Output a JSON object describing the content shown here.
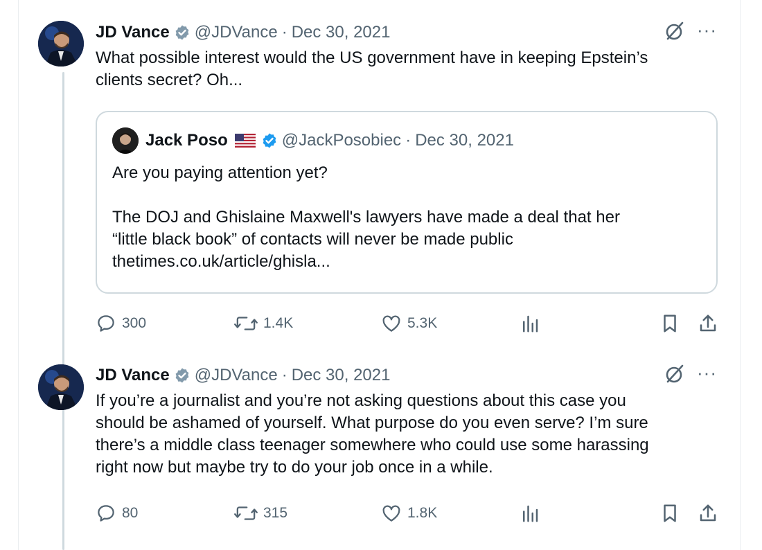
{
  "tweets": [
    {
      "author": {
        "name": "JD Vance",
        "handle": "@JDVance",
        "date": "Dec 30, 2021"
      },
      "text": "What possible interest would the US government have in keeping Epstein’s\nclients secret? Oh...",
      "quote": {
        "author": {
          "name": "Jack Poso",
          "handle": "@JackPosobiec",
          "date": "Dec 30, 2021"
        },
        "text": "Are you paying attention yet?\n\nThe DOJ and Ghislaine Maxwell's lawyers have made a deal that her\n“little black book” of contacts will never be made public\nthetimes.co.uk/article/ghisla..."
      },
      "stats": {
        "replies": "300",
        "reposts": "1.4K",
        "likes": "5.3K"
      }
    },
    {
      "author": {
        "name": "JD Vance",
        "handle": "@JDVance",
        "date": "Dec 30, 2021"
      },
      "text": "If you’re a journalist and you’re not asking questions about this case you\nshould be ashamed of yourself. What purpose do you even serve? I’m sure\nthere’s a middle class teenager somewhere who could use some harassing\nright now but maybe try to do your job once in a while.",
      "stats": {
        "replies": "80",
        "reposts": "315",
        "likes": "1.8K"
      }
    }
  ],
  "ui": {
    "separator": "·",
    "more": "···"
  },
  "colors": {
    "verified": "#829aab",
    "muted": "#536471",
    "text": "#0f1419",
    "border": "#cfd9de"
  },
  "icons": [
    "verified-badge-icon",
    "grok-icon",
    "more-icon",
    "reply-icon",
    "repost-icon",
    "like-icon",
    "views-icon",
    "bookmark-icon",
    "share-icon",
    "us-flag-icon"
  ]
}
